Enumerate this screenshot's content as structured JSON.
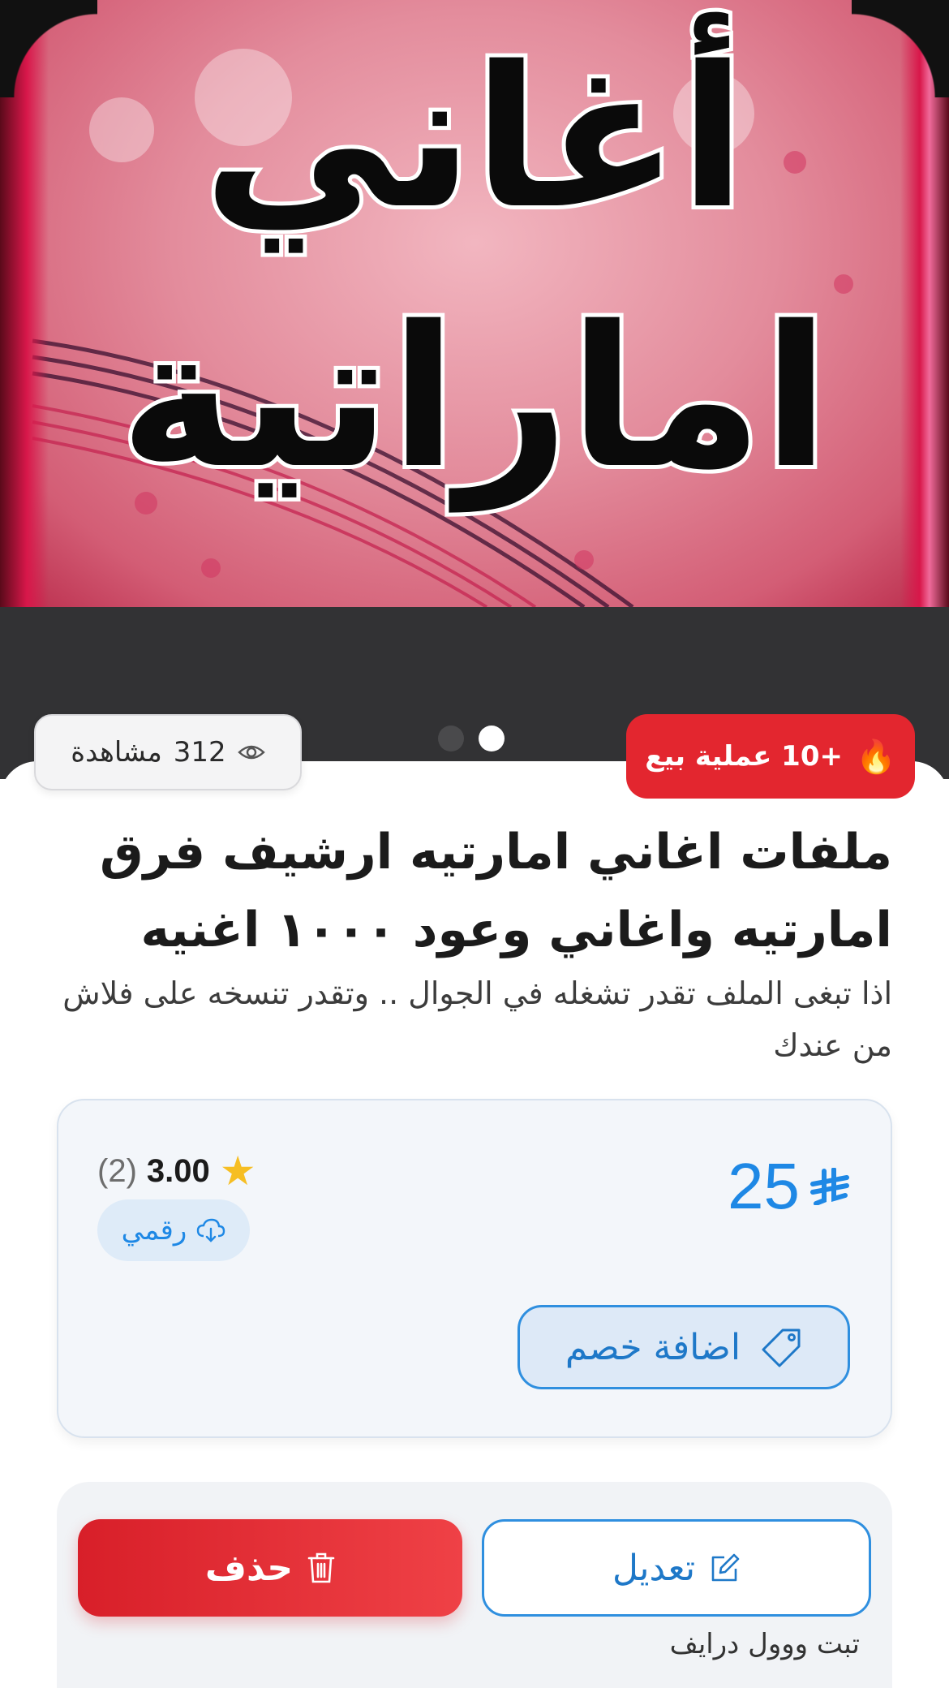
{
  "hero": {
    "title_line1": "أغاني",
    "title_line2": "اماراتية",
    "active_slide": 2,
    "slide_count": 2
  },
  "stats": {
    "views_count": "312",
    "views_label": "مشاهدة",
    "sales_label": "+10 عملية بيع"
  },
  "product": {
    "title": "ملفات اغاني امارتيه ارشيف فرق امارتيه واغاني وعود ١٠٠٠ اغنيه",
    "description": "اذا تبغى الملف تقدر تشغله في الجوال .. وتقدر تنسخه على فلاش من عندك"
  },
  "pricing": {
    "price": "25",
    "rating_score": "3.00",
    "rating_count": "(2)",
    "type_label": "رقمي",
    "discount_button": "اضافة خصم"
  },
  "actions": {
    "edit_label": "تعديل",
    "delete_label": "حذف",
    "footnote": "تبت ووول درايف"
  },
  "colors": {
    "accent_blue": "#1e88e5",
    "danger_red": "#e3262f",
    "star": "#f6be23",
    "hero_bg": "#323234"
  },
  "icons": {
    "views": "eye-icon",
    "sales": "flame-icon",
    "rating": "star-icon",
    "type": "cloud-download-icon",
    "discount": "tag-icon",
    "edit": "edit-icon",
    "delete": "trash-icon"
  }
}
